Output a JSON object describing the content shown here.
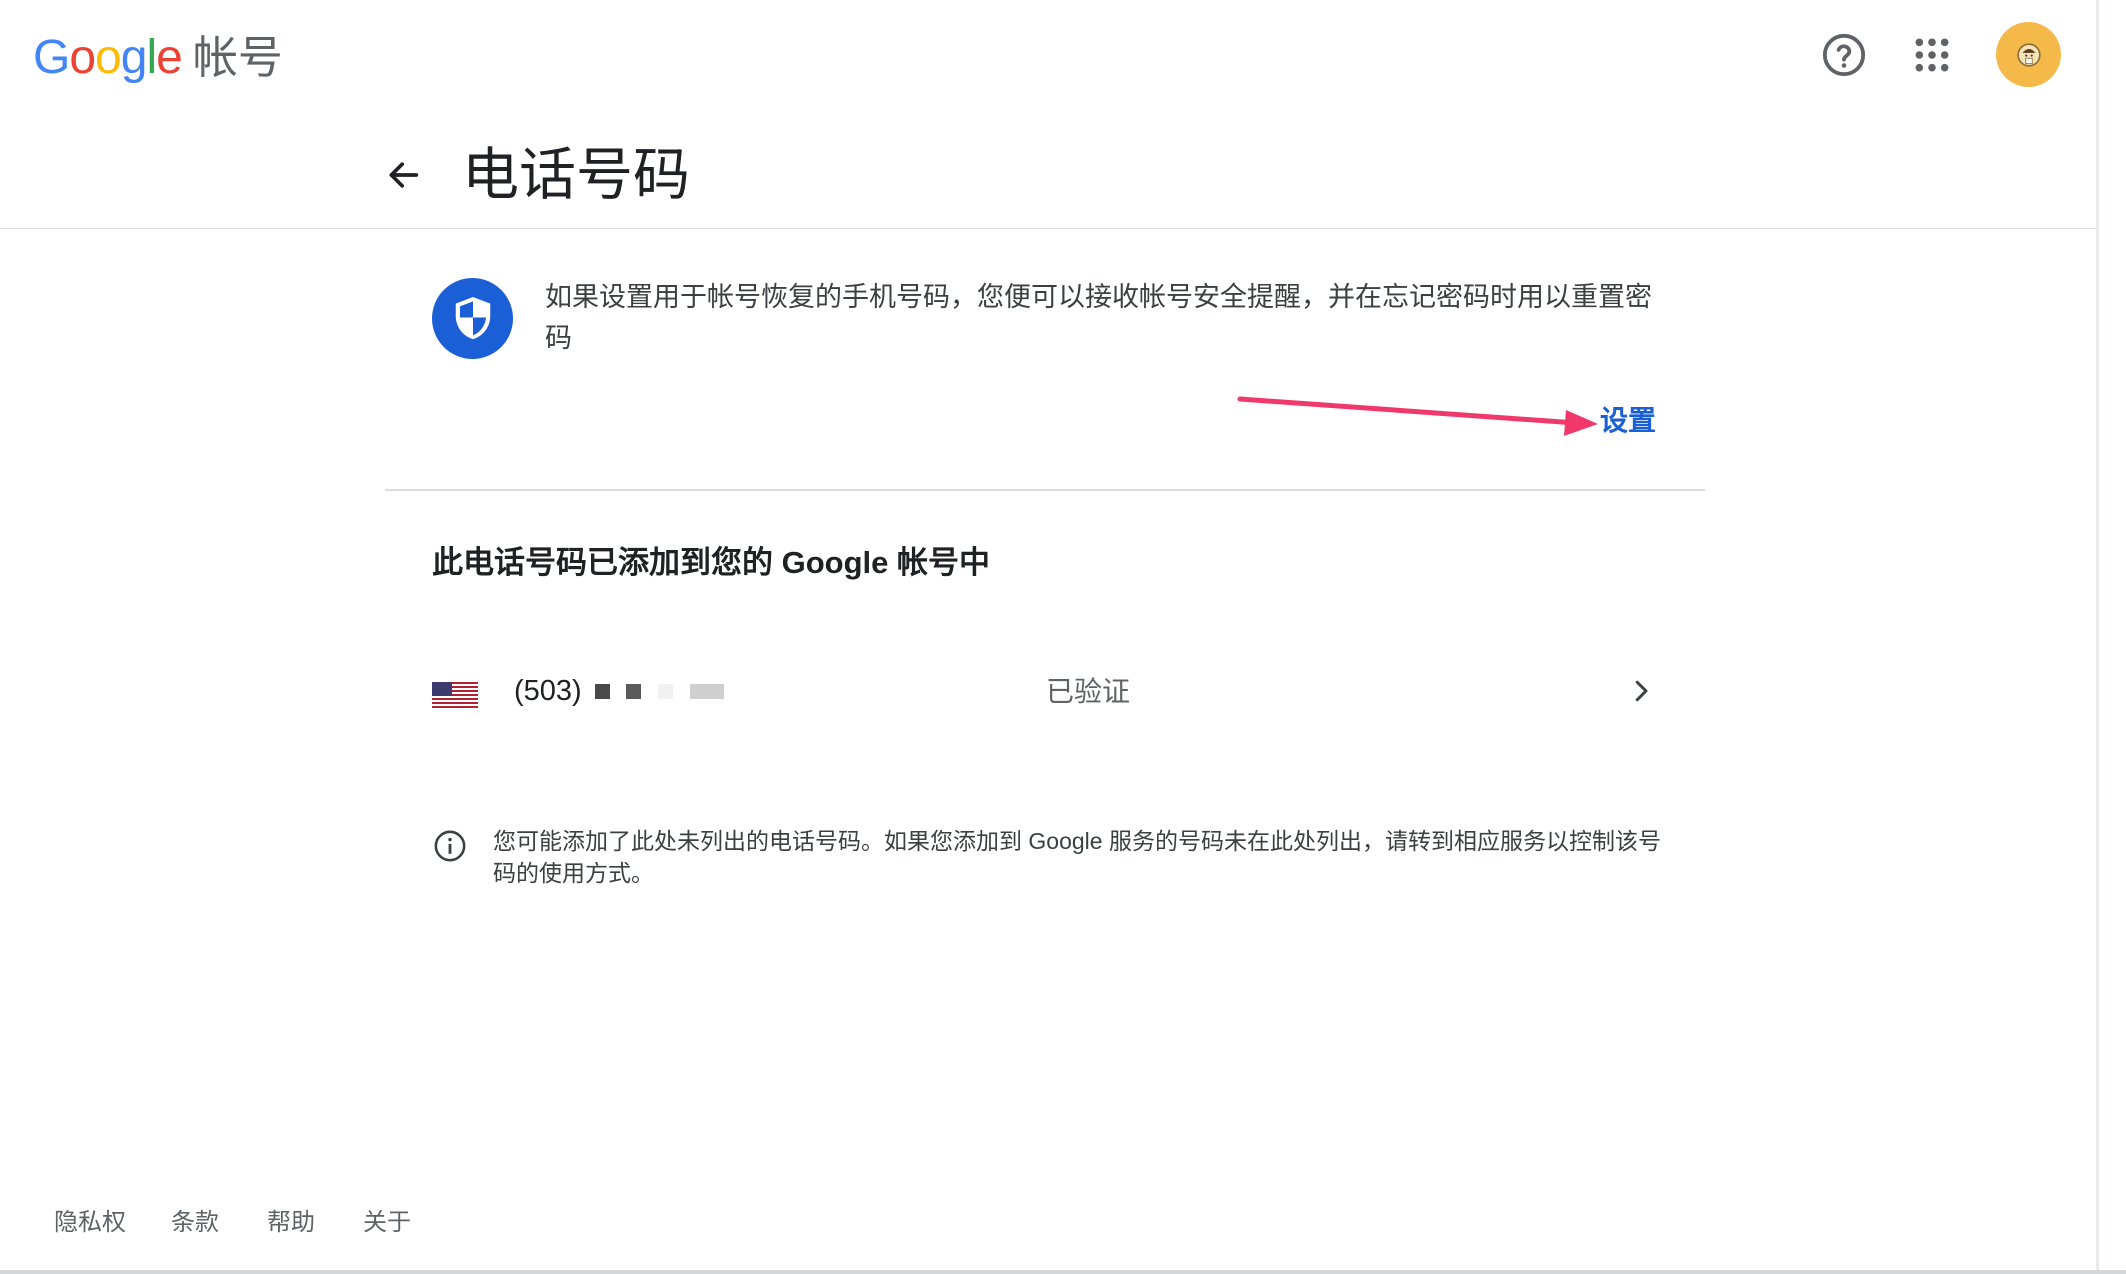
{
  "header": {
    "logo_text": "Google",
    "logo_suffix": "帐号",
    "help_icon": "help-circle-icon",
    "apps_icon": "apps-grid-icon",
    "avatar_icon": "user-avatar"
  },
  "page": {
    "title": "电话号码",
    "back_icon": "arrow-left-icon"
  },
  "promo": {
    "icon": "shield-icon",
    "text": "如果设置用于帐号恢复的手机号码，您便可以接收帐号安全提醒，并在忘记密码时用以重置密码",
    "setup_label": "设置"
  },
  "phones": {
    "heading": "此电话号码已添加到您的 Google 帐号中",
    "items": [
      {
        "flag": "us-flag-icon",
        "number": "(503)",
        "status": "已验证"
      }
    ]
  },
  "note": {
    "icon": "info-icon",
    "text": "您可能添加了此处未列出的电话号码。如果您添加到 Google 服务的号码未在此处列出，请转到相应服务以控制该号码的使用方式。"
  },
  "footer": {
    "links": [
      "隐私权",
      "条款",
      "帮助",
      "关于"
    ]
  },
  "colors": {
    "accent": "#1a5fd6",
    "annotation_arrow": "#f0386b",
    "avatar_bg": "#f5b94a"
  }
}
